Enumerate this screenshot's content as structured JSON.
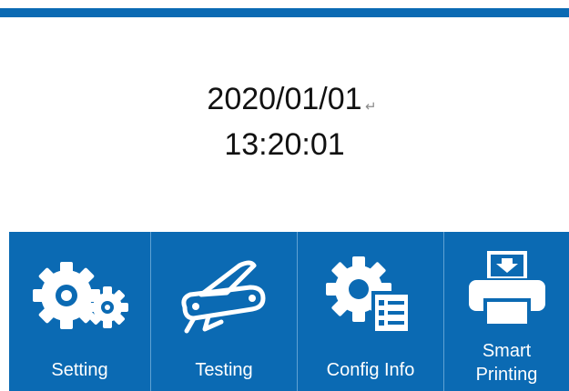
{
  "datetime": {
    "date": "2020/01/01",
    "time": "13:20:01"
  },
  "menu": {
    "tiles": [
      {
        "label": "Setting",
        "icon": "gears-icon"
      },
      {
        "label": "Testing",
        "icon": "swiss-army-knife-icon"
      },
      {
        "label": "Config Info",
        "icon": "gear-checklist-icon"
      },
      {
        "label_line1": "Smart",
        "label_line2": "Printing",
        "icon": "printer-icon"
      }
    ]
  },
  "colors": {
    "accent": "#0b6ab3",
    "tile_divider": "#5fa1d3",
    "text": "#111111"
  }
}
